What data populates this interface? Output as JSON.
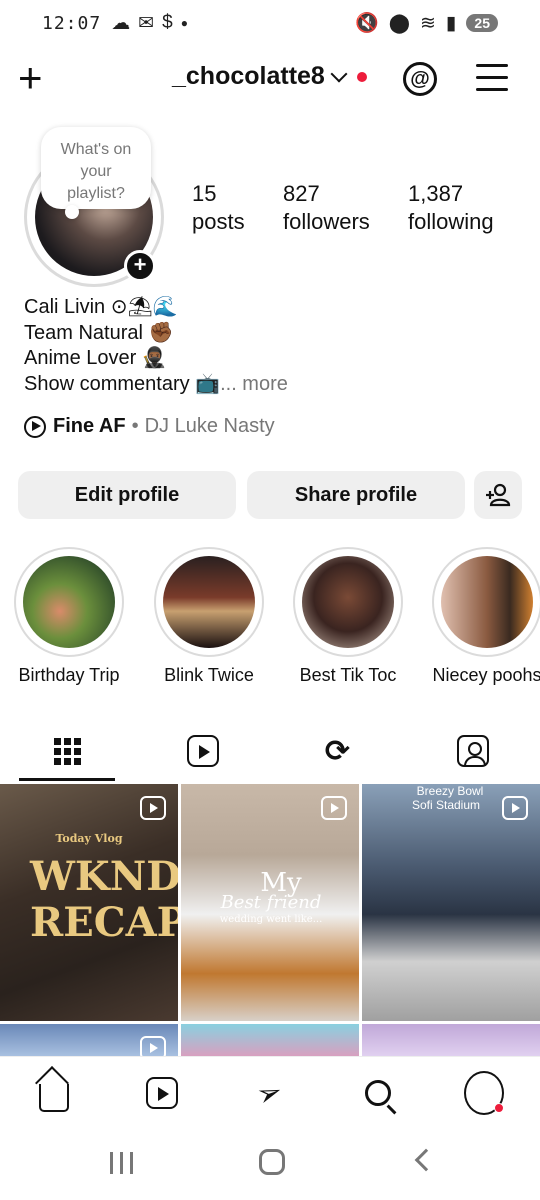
{
  "status_bar": {
    "time": "12:07",
    "battery": "25"
  },
  "header": {
    "username": "_chocolatte8"
  },
  "profile": {
    "note_placeholder": "What's on your playlist?",
    "stats": [
      {
        "number": "15",
        "label": "posts"
      },
      {
        "number": "827",
        "label": "followers"
      },
      {
        "number": "1,387",
        "label": "following"
      }
    ],
    "bio": [
      "Cali Livin ⊙⛱🌊",
      "Team Natural ✊🏾",
      "Anime Lover 🥷🏾",
      "Show commentary 📺"
    ],
    "bio_more": "... more",
    "music": {
      "song": "Fine AF",
      "separator": "•",
      "artist": "DJ Luke Nasty"
    }
  },
  "buttons": {
    "edit_profile": "Edit profile",
    "share_profile": "Share profile",
    "discover_people_icon": "add-person-icon"
  },
  "highlights": [
    {
      "label": "Birthday Trip",
      "color": "#5f8a3c"
    },
    {
      "label": "Blink Twice",
      "color": "#3a2a2a"
    },
    {
      "label": "Best Tik Toc",
      "color": "#8a5a48"
    },
    {
      "label": "Niecey poohs",
      "color": "#a0603a"
    }
  ],
  "tabs": [
    {
      "icon": "grid-icon",
      "active": true
    },
    {
      "icon": "reels-icon",
      "active": false
    },
    {
      "icon": "reposts-icon",
      "active": false
    },
    {
      "icon": "tagged-icon",
      "active": false
    }
  ],
  "posts": [
    {
      "type": "reel",
      "overlay_small": "Today Vlog",
      "overlay_title": "WKND RECAP"
    },
    {
      "type": "reel",
      "overlay_title": "My",
      "overlay_script": "Best friend",
      "overlay_sub": "wedding went like..."
    },
    {
      "type": "reel",
      "overlay_title": "Breezy Bowl",
      "overlay_sub": "Sofi Stadium"
    }
  ],
  "bottom_nav": [
    "home-icon",
    "reels-icon",
    "direct-icon",
    "search-icon",
    "profile-avatar"
  ],
  "colors": {
    "accent_red": "#ed1c3b",
    "button_bg": "#efefef",
    "muted_text": "#777777"
  }
}
